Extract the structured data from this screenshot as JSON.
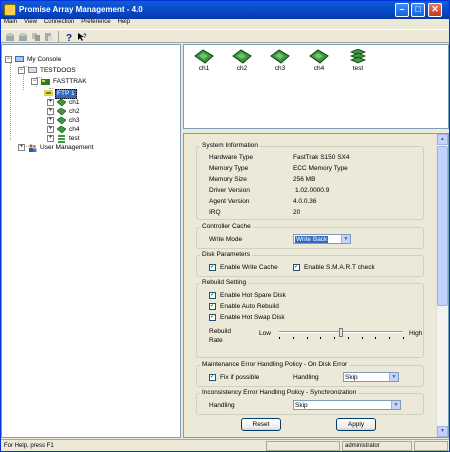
{
  "window": {
    "title": "Promise Array Management - 4.0"
  },
  "menu": [
    {
      "label": "Main"
    },
    {
      "label": "View"
    },
    {
      "label": "Connection"
    },
    {
      "label": "Preference"
    },
    {
      "label": "Help"
    }
  ],
  "tree": {
    "root": "My Console",
    "host": "TESTDOOS",
    "controller": "FASTTRAK",
    "array": "FTP 1",
    "children": [
      "ch1",
      "ch2",
      "ch3",
      "ch4",
      "test"
    ],
    "user_mgmt": "User Management"
  },
  "icon_view": {
    "items": [
      {
        "label": "ch1",
        "icon": "drive-icon"
      },
      {
        "label": "ch2",
        "icon": "drive-icon"
      },
      {
        "label": "ch3",
        "icon": "drive-icon"
      },
      {
        "label": "ch4",
        "icon": "drive-icon"
      },
      {
        "label": "test",
        "icon": "array-stack-icon"
      }
    ]
  },
  "system_info": {
    "title": "System Information",
    "rows": [
      {
        "label": "Hardware Type",
        "value": "FastTrak S150 SX4"
      },
      {
        "label": "Memory Type",
        "value": "ECC Memory Type"
      },
      {
        "label": "Memory Size",
        "value": "256 MB"
      },
      {
        "label": "Driver Version",
        "value": "1.02.0000.9"
      },
      {
        "label": "Agent Version",
        "value": "4.0.0.36"
      },
      {
        "label": "IRQ",
        "value": "20"
      }
    ]
  },
  "controller_cache": {
    "title": "Controller Cache",
    "write_mode_label": "Write Mode",
    "write_mode_value": "Write Back"
  },
  "disk_params": {
    "title": "Disk Parameters",
    "write_cache": {
      "label": "Enable Write Cache",
      "checked": true
    },
    "smart": {
      "label": "Enable S.M.A.R.T check",
      "checked": true
    }
  },
  "rebuild": {
    "title": "Rebuild Setting",
    "hot_spare": {
      "label": "Enable Hot Spare Disk",
      "checked": true
    },
    "auto_rebuild": {
      "label": "Enable Auto Rebuild",
      "checked": true
    },
    "hot_swap": {
      "label": "Enable Hot Swap Disk",
      "checked": true
    },
    "rate_label_1": "Rebuild",
    "rate_label_2": "Rate",
    "low": "Low",
    "high": "High",
    "rate_fraction": 0.5
  },
  "maint_policy": {
    "title": "Maintenance Error Handling Policy - On Disk Error",
    "fix": {
      "label": "Fix if possible",
      "checked": true
    },
    "handling_label": "Handling",
    "handling_value": "Skip"
  },
  "incon_policy": {
    "title": "Inconsistency Error Handling Policy - Synchronization",
    "handling_label": "Handling",
    "handling_value": "Skip"
  },
  "buttons": {
    "reset": "Reset",
    "apply": "Apply"
  },
  "status": {
    "help": "For Help, press F1",
    "user": "administrator"
  },
  "colors": {
    "title_bar": "#0a5ed9",
    "selection": "#316ac5",
    "drive_green": "#3c9a3c"
  }
}
